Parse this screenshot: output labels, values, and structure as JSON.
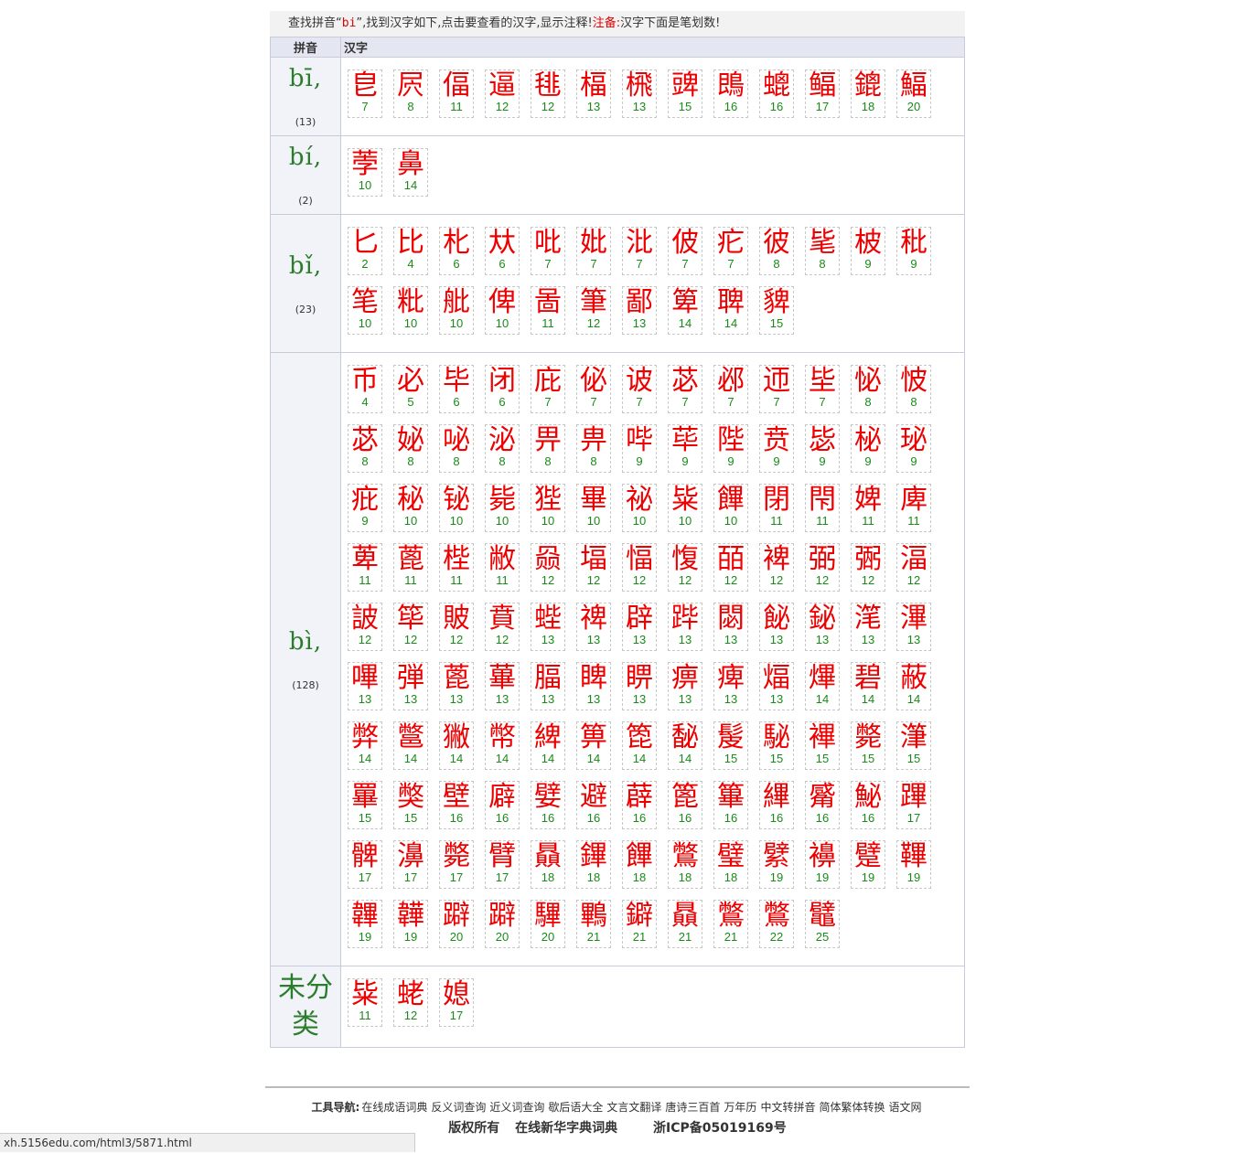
{
  "header": {
    "text_prefix": "查找拼音“",
    "pinyin": "bi",
    "text_mid": "”,找到汉字如下,点击要查看的汉字,显示注释!",
    "note_label": "注备:",
    "note_text": "汉字下面是笔划数!"
  },
  "table_headers": {
    "pinyin": "拼音",
    "hanzi": "汉字"
  },
  "groups": [
    {
      "pinyin": "bī,",
      "count": "(13)",
      "chars": [
        [
          "皀",
          "7"
        ],
        [
          "屄",
          "8"
        ],
        [
          "偪",
          "11"
        ],
        [
          "逼",
          "12"
        ],
        [
          "毴",
          "12"
        ],
        [
          "楅",
          "13"
        ],
        [
          "榌",
          "13"
        ],
        [
          "豍",
          "15"
        ],
        [
          "鵖",
          "16"
        ],
        [
          "螕",
          "16"
        ],
        [
          "鲾",
          "17"
        ],
        [
          "鎞",
          "18"
        ],
        [
          "鰏",
          "20"
        ]
      ]
    },
    {
      "pinyin": "bí,",
      "count": "(2)",
      "chars": [
        [
          "荸",
          "10"
        ],
        [
          "鼻",
          "14"
        ]
      ]
    },
    {
      "pinyin": "bǐ,",
      "count": "(23)",
      "chars": [
        [
          "匕",
          "2"
        ],
        [
          "比",
          "4"
        ],
        [
          "朼",
          "6"
        ],
        [
          "夶",
          "6"
        ],
        [
          "吡",
          "7"
        ],
        [
          "妣",
          "7"
        ],
        [
          "沘",
          "7"
        ],
        [
          "佊",
          "7"
        ],
        [
          "疕",
          "7"
        ],
        [
          "彼",
          "8"
        ],
        [
          "毞",
          "8"
        ],
        [
          "柀",
          "9"
        ],
        [
          "秕",
          "9"
        ],
        [
          "笔",
          "10"
        ],
        [
          "粃",
          "10"
        ],
        [
          "舭",
          "10"
        ],
        [
          "俾",
          "10"
        ],
        [
          "啚",
          "11"
        ],
        [
          "筆",
          "12"
        ],
        [
          "鄙",
          "13"
        ],
        [
          "箄",
          "14"
        ],
        [
          "聛",
          "14"
        ],
        [
          "貏",
          "15"
        ]
      ]
    },
    {
      "pinyin": "bì,",
      "count": "(128)",
      "chars": [
        [
          "币",
          "4"
        ],
        [
          "必",
          "5"
        ],
        [
          "毕",
          "6"
        ],
        [
          "闭",
          "6"
        ],
        [
          "庇",
          "7"
        ],
        [
          "佖",
          "7"
        ],
        [
          "诐",
          "7"
        ],
        [
          "苾",
          "7"
        ],
        [
          "邲",
          "7"
        ],
        [
          "迊",
          "7"
        ],
        [
          "坒",
          "7"
        ],
        [
          "怭",
          "8"
        ],
        [
          "怶",
          "8"
        ],
        [
          "苾",
          "8"
        ],
        [
          "妼",
          "8"
        ],
        [
          "咇",
          "8"
        ],
        [
          "泌",
          "8"
        ],
        [
          "畀",
          "8"
        ],
        [
          "畁",
          "8"
        ],
        [
          "哔",
          "9"
        ],
        [
          "荜",
          "9"
        ],
        [
          "陛",
          "9"
        ],
        [
          "贲",
          "9"
        ],
        [
          "毖",
          "9"
        ],
        [
          "柲",
          "9"
        ],
        [
          "珌",
          "9"
        ],
        [
          "疪",
          "9"
        ],
        [
          "秘",
          "10"
        ],
        [
          "铋",
          "10"
        ],
        [
          "毙",
          "10"
        ],
        [
          "狴",
          "10"
        ],
        [
          "畢",
          "10"
        ],
        [
          "祕",
          "10"
        ],
        [
          "粊",
          "10"
        ],
        [
          "饆",
          "10"
        ],
        [
          "閉",
          "11"
        ],
        [
          "閇",
          "11"
        ],
        [
          "婢",
          "11"
        ],
        [
          "庳",
          "11"
        ],
        [
          "萆",
          "11"
        ],
        [
          "蓖",
          "11"
        ],
        [
          "梐",
          "11"
        ],
        [
          "敝",
          "11"
        ],
        [
          "赑",
          "12"
        ],
        [
          "堛",
          "12"
        ],
        [
          "愊",
          "12"
        ],
        [
          "愎",
          "12"
        ],
        [
          "皕",
          "12"
        ],
        [
          "裨",
          "12"
        ],
        [
          "弼",
          "12"
        ],
        [
          "弻",
          "12"
        ],
        [
          "湢",
          "12"
        ],
        [
          "詖",
          "12"
        ],
        [
          "筚",
          "12"
        ],
        [
          "貱",
          "12"
        ],
        [
          "賁",
          "12"
        ],
        [
          "蜌",
          "13"
        ],
        [
          "禆",
          "13"
        ],
        [
          "辟",
          "13"
        ],
        [
          "跸",
          "13"
        ],
        [
          "閟",
          "13"
        ],
        [
          "飶",
          "13"
        ],
        [
          "鉍",
          "13"
        ],
        [
          "滗",
          "13"
        ],
        [
          "滭",
          "13"
        ],
        [
          "嗶",
          "13"
        ],
        [
          "弾",
          "13"
        ],
        [
          "蓖",
          "13"
        ],
        [
          "蓽",
          "13"
        ],
        [
          "腷",
          "13"
        ],
        [
          "睥",
          "13"
        ],
        [
          "睤",
          "13"
        ],
        [
          "痹",
          "13"
        ],
        [
          "痺",
          "13"
        ],
        [
          "煏",
          "13"
        ],
        [
          "熚",
          "14"
        ],
        [
          "碧",
          "14"
        ],
        [
          "蔽",
          "14"
        ],
        [
          "弊",
          "14"
        ],
        [
          "鄨",
          "14"
        ],
        [
          "獙",
          "14"
        ],
        [
          "幣",
          "14"
        ],
        [
          "綼",
          "14"
        ],
        [
          "箅",
          "14"
        ],
        [
          "箆",
          "14"
        ],
        [
          "馝",
          "14"
        ],
        [
          "髲",
          "15"
        ],
        [
          "駜",
          "15"
        ],
        [
          "襅",
          "15"
        ],
        [
          "斃",
          "15"
        ],
        [
          "潷",
          "15"
        ],
        [
          "罼",
          "15"
        ],
        [
          "獘",
          "15"
        ],
        [
          "壁",
          "16"
        ],
        [
          "廦",
          "16"
        ],
        [
          "嬖",
          "16"
        ],
        [
          "避",
          "16"
        ],
        [
          "薜",
          "16"
        ],
        [
          "篦",
          "16"
        ],
        [
          "篳",
          "16"
        ],
        [
          "縪",
          "16"
        ],
        [
          "觱",
          "16"
        ],
        [
          "鮅",
          "16"
        ],
        [
          "蹕",
          "17"
        ],
        [
          "髀",
          "17"
        ],
        [
          "濞",
          "17"
        ],
        [
          "斃",
          "17"
        ],
        [
          "臂",
          "17"
        ],
        [
          "贔",
          "18"
        ],
        [
          "鏎",
          "18"
        ],
        [
          "饆",
          "18"
        ],
        [
          "鷩",
          "18"
        ],
        [
          "璧",
          "18"
        ],
        [
          "繴",
          "19"
        ],
        [
          "襣",
          "19"
        ],
        [
          "躄",
          "19"
        ],
        [
          "鞸",
          "19"
        ],
        [
          "韠",
          "19"
        ],
        [
          "韡",
          "19"
        ],
        [
          "躃",
          "20"
        ],
        [
          "躃",
          "20"
        ],
        [
          "驆",
          "20"
        ],
        [
          "鷝",
          "21"
        ],
        [
          "鐴",
          "21"
        ],
        [
          "贔",
          "21"
        ],
        [
          "鷩",
          "21"
        ],
        [
          "鷩",
          "22"
        ],
        [
          "鼊",
          "25"
        ]
      ]
    },
    {
      "pinyin": "未分类",
      "count": "",
      "chars": [
        [
          "粊",
          "11"
        ],
        [
          "蛯",
          "12"
        ],
        [
          "媳",
          "17"
        ]
      ]
    }
  ],
  "footer": {
    "nav_label": "工具导航:",
    "links": [
      "在线成语词典",
      "反义词查询",
      "近义词查询",
      "歇后语大全",
      "文言文翻译",
      "唐诗三百首",
      "万年历",
      "中文转拼音",
      "简体繁体转换",
      "语文网"
    ],
    "copyright": "版权所有",
    "site": "在线新华字典词典",
    "icp": "浙ICP备05019169号"
  },
  "status_url": "xh.5156edu.com/html3/5871.html"
}
